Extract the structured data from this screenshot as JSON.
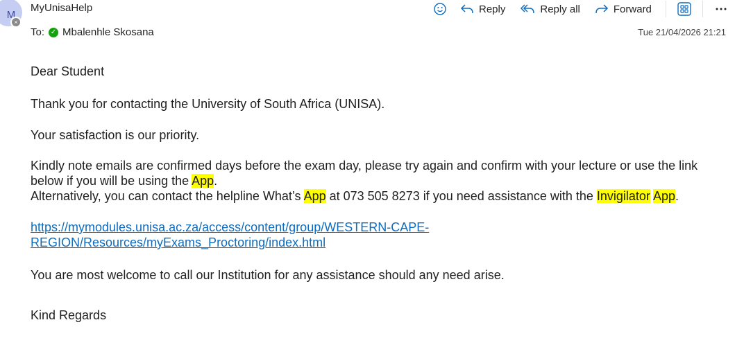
{
  "header": {
    "avatar_initial": "M",
    "sender": "MyUnisaHelp",
    "to_label": "To:",
    "recipient": "Mbalenhle Skosana",
    "timestamp": "Tue 21/04/2026 21:21"
  },
  "toolbar": {
    "reply": "Reply",
    "reply_all": "Reply all",
    "forward": "Forward"
  },
  "icons": {
    "emoji": "emoji-icon",
    "reply": "reply-icon",
    "reply_all": "reply-all-icon",
    "forward": "forward-icon",
    "apps": "apps-icon",
    "more": "more-icon",
    "presence": "presence-blocked-icon",
    "verified": "check-icon"
  },
  "colors": {
    "link": "#0f6cbd",
    "highlight": "#ffff00",
    "accent": "#0f6cbd",
    "avatar_bg": "#c5cdf3",
    "presence_ok": "#13a10e"
  },
  "message": {
    "greeting": "Dear Student",
    "p1": "Thank you for contacting the University of South Africa (UNISA).",
    "p2": "Your satisfaction is our priority.",
    "p3_a": "Kindly note emails are confirmed days before the exam day, please try again and confirm with your lecture or use the link below if you will be using the ",
    "p3_app1": "App",
    "p3_b": ".",
    "p3_c": "Alternatively, you can contact the helpline What’s ",
    "p3_app2": "App",
    "p3_d": " at 073 505 8273 if you need assistance with the ",
    "p3_invig": "Invigilator",
    "p3_e": " ",
    "p3_app3": "App",
    "p3_f": ".",
    "link_line1": "https://mymodules.unisa.ac.za/access/content/group/WESTERN-CAPE-",
    "link_line2": "REGION/Resources/myExams_Proctoring/index.html",
    "p4": "You are most welcome to call our Institution for any assistance should any need arise.",
    "closing": "Kind Regards"
  }
}
